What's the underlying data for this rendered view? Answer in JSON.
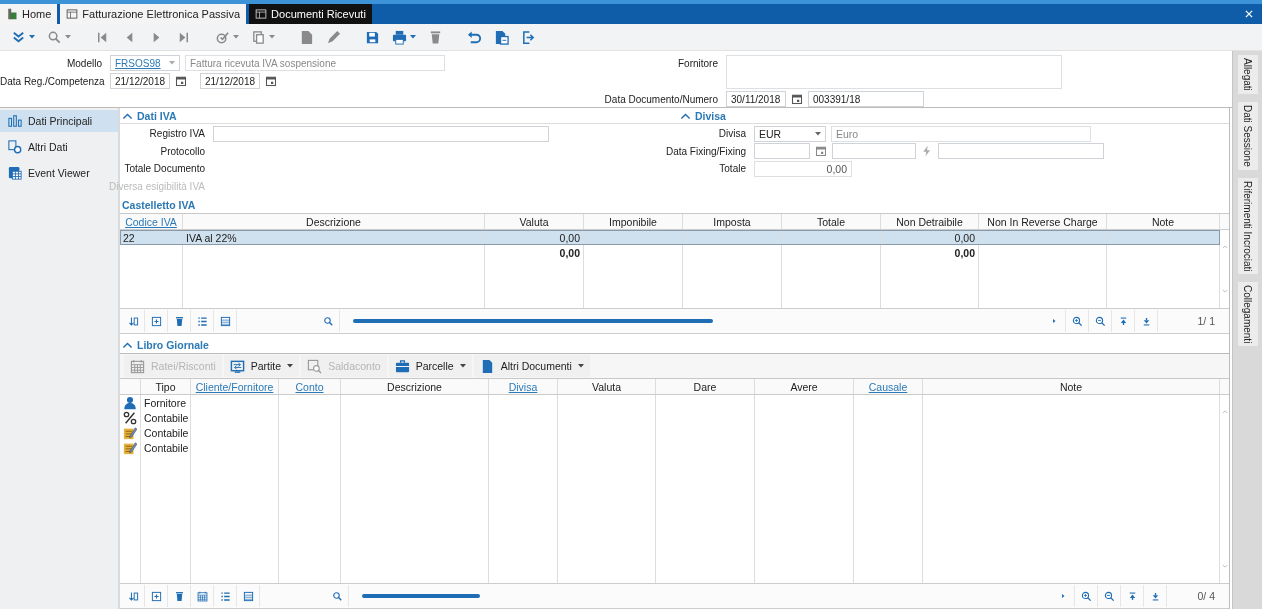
{
  "window_tabs": [
    {
      "label": "Home",
      "kind": "home",
      "selected": false
    },
    {
      "label": "Fatturazione Elettronica Passiva",
      "kind": "window",
      "selected": false
    },
    {
      "label": "Documenti Ricevuti",
      "kind": "window",
      "selected": true
    }
  ],
  "toolbar": [
    {
      "kind": "expand",
      "disabled": false,
      "dropdown": true
    },
    {
      "kind": "search",
      "disabled": true,
      "dropdown": true
    },
    {
      "kind": "first",
      "disabled": true,
      "dropdown": false
    },
    {
      "kind": "prev",
      "disabled": true,
      "dropdown": false
    },
    {
      "kind": "next",
      "disabled": true,
      "dropdown": false
    },
    {
      "kind": "last",
      "disabled": true,
      "dropdown": false
    },
    {
      "kind": "check",
      "disabled": true,
      "dropdown": true
    },
    {
      "kind": "copy",
      "disabled": true,
      "dropdown": true
    },
    {
      "kind": "new",
      "disabled": true,
      "dropdown": false
    },
    {
      "kind": "edit",
      "disabled": true,
      "dropdown": false
    },
    {
      "kind": "save",
      "disabled": false,
      "dropdown": false
    },
    {
      "kind": "print",
      "disabled": false,
      "dropdown": true
    },
    {
      "kind": "delete",
      "disabled": true,
      "dropdown": false
    },
    {
      "kind": "undo",
      "disabled": false,
      "dropdown": false
    },
    {
      "kind": "attach",
      "disabled": false,
      "dropdown": false
    },
    {
      "kind": "exit",
      "disabled": false,
      "dropdown": false
    }
  ],
  "header": {
    "modello": {
      "label": "Modello",
      "code": "FRSOS98",
      "description": "Fattura ricevuta IVA sospensione"
    },
    "data_reg": {
      "label": "Data Reg./Competenza",
      "dates": [
        "21/12/2018",
        "21/12/2018"
      ]
    },
    "fornitore": {
      "label": "Fornitore"
    },
    "data_documento": {
      "label": "Data Documento/Numero",
      "date": "30/11/2018",
      "number": "003391/18"
    }
  },
  "sidebar": {
    "items": [
      {
        "label": "Dati Principali",
        "kind": "chart",
        "selected": true
      },
      {
        "label": "Altri Dati",
        "kind": "gear",
        "selected": false
      },
      {
        "label": "Event Viewer",
        "kind": "grid",
        "selected": false
      }
    ]
  },
  "right_tabs": [
    "Allegati",
    "Dati Sessione",
    "Riferimenti Incrociati",
    "Collegamenti"
  ],
  "dati_iva": {
    "title": "Dati IVA",
    "expanded": true,
    "fields": [
      {
        "label": "Registro IVA",
        "disabled": false
      },
      {
        "label": "Protocollo",
        "disabled": false
      },
      {
        "label": "Totale Documento",
        "disabled": false
      },
      {
        "label": "Diversa esigibilità IVA",
        "disabled": true
      }
    ]
  },
  "divisa": {
    "title": "Divisa",
    "expanded": true,
    "divisa": {
      "label": "Divisa",
      "code": "EUR",
      "name": "Euro"
    },
    "fixing": {
      "label": "Data Fixing/Fixing"
    },
    "totale": {
      "label": "Totale",
      "value": "0,00"
    }
  },
  "castelletto": {
    "title": "Castelletto IVA",
    "columns": [
      {
        "label": "Codice IVA",
        "link": true
      },
      {
        "label": "Descrizione",
        "link": false
      },
      {
        "label": "Valuta",
        "link": false
      },
      {
        "label": "Imponibile",
        "link": false
      },
      {
        "label": "Imposta",
        "link": false
      },
      {
        "label": "Totale",
        "link": false
      },
      {
        "label": "Non Detraibile",
        "link": false
      },
      {
        "label": "Non In Reverse Charge",
        "link": false
      },
      {
        "label": "Note",
        "link": false
      }
    ],
    "rows": [
      {
        "kind": "data",
        "selected": true,
        "codice_iva": "22",
        "descrizione": "IVA al 22%",
        "valuta": "0,00",
        "non_detraibile": "0,00"
      },
      {
        "kind": "total",
        "selected": false,
        "valuta": "0,00",
        "non_detraibile": "0,00"
      }
    ],
    "tools": [
      {
        "kind": "sort"
      },
      {
        "kind": "add"
      },
      {
        "kind": "delete"
      },
      {
        "kind": "list"
      },
      {
        "kind": "detail"
      }
    ],
    "pager": "1/ 1"
  },
  "libro_giornale": {
    "title": "Libro Giornale",
    "expanded": true,
    "actions": [
      {
        "label": "Ratei/Risconti",
        "kind": "calendar",
        "disabled": true,
        "dropdown": false
      },
      {
        "label": "Partite",
        "kind": "transfer",
        "disabled": false,
        "dropdown": true
      },
      {
        "label": "Saldaconto",
        "kind": "lookup",
        "disabled": true,
        "dropdown": false
      },
      {
        "label": "Parcelle",
        "kind": "briefcase",
        "disabled": false,
        "dropdown": true
      },
      {
        "label": "Altri Documenti",
        "kind": "document",
        "disabled": false,
        "dropdown": true
      }
    ],
    "columns": [
      {
        "label": "Tipo",
        "link": false
      },
      {
        "label": "Cliente/Fornitore",
        "link": true
      },
      {
        "label": "Conto",
        "link": true
      },
      {
        "label": "Descrizione",
        "link": false
      },
      {
        "label": "Divisa",
        "link": true
      },
      {
        "label": "Valuta",
        "link": false
      },
      {
        "label": "Dare",
        "link": false
      },
      {
        "label": "Avere",
        "link": false
      },
      {
        "label": "Causale",
        "link": true
      },
      {
        "label": "Note",
        "link": false
      }
    ],
    "rows": [
      {
        "kind": "person",
        "selected": false,
        "tipo": "Fornitore"
      },
      {
        "kind": "percent",
        "selected": false,
        "tipo": "Contabile"
      },
      {
        "kind": "note",
        "selected": false,
        "tipo": "Contabile"
      },
      {
        "kind": "note",
        "selected": false,
        "tipo": "Contabile"
      }
    ],
    "tools": [
      {
        "kind": "sort"
      },
      {
        "kind": "add"
      },
      {
        "kind": "delete"
      },
      {
        "kind": "calendar"
      },
      {
        "kind": "list"
      },
      {
        "kind": "detail"
      }
    ],
    "pager": "0/ 4"
  }
}
